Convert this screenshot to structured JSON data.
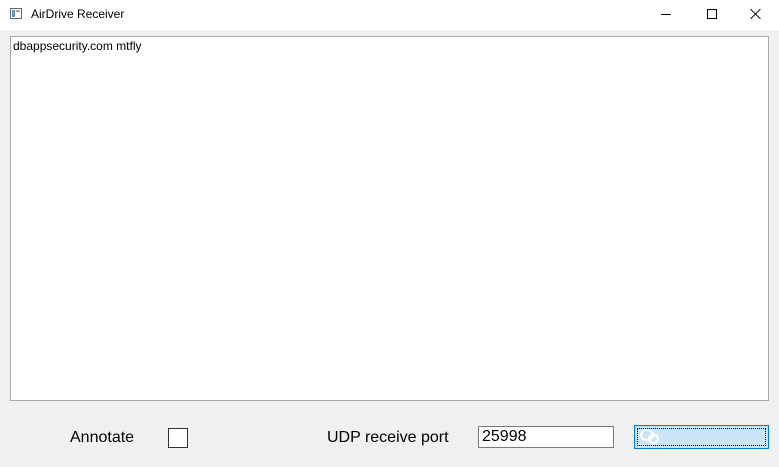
{
  "window": {
    "title": "AirDrive Receiver",
    "app_icon": "window-app-icon",
    "controls": {
      "minimize_icon": "minimize-icon",
      "maximize_icon": "maximize-icon",
      "close_icon": "close-icon"
    }
  },
  "log": {
    "text": "dbappsecurity.com mtfly"
  },
  "bottom_bar": {
    "annotate_label": "Annotate",
    "annotate_checked": false,
    "udp_label": "UDP receive port",
    "udp_port_value": "25998",
    "watermark_icon": "wechat-icon"
  },
  "colors": {
    "window_bg": "#f0f0f0",
    "button_accent": "#0078d7",
    "button_bg": "#cce4f7"
  }
}
